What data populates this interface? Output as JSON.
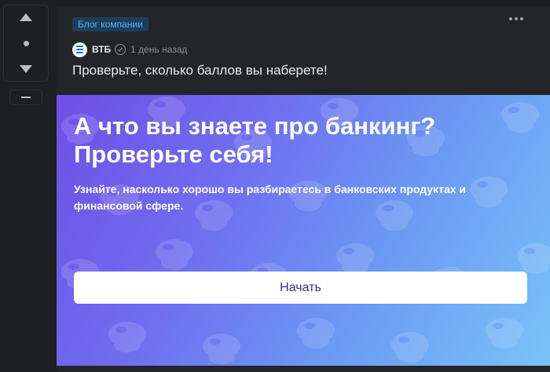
{
  "post": {
    "tag": "Блог компании",
    "author": "ВТБ",
    "time": "1 день назад",
    "title": "Проверьте, сколько баллов вы наберете!"
  },
  "banner": {
    "heading_line1": "А что вы знаете про банкинг?",
    "heading_line2": "Проверьте себя!",
    "subtitle": "Узнайте, насколько хорошо вы разбираетесь в банковских продуктах и финансовой сфере.",
    "button_label": "Начать"
  },
  "colors": {
    "page_bg": "#1d1f22",
    "card_bg": "#232528",
    "tag_bg": "#1d3d5c",
    "tag_text": "#5fb0ee",
    "button_text": "#3f2e84"
  },
  "icons": [
    "upvote-arrow-icon",
    "vote-dot-icon",
    "downvote-arrow-icon",
    "collapse-icon",
    "vtb-logo-icon",
    "verified-check-icon",
    "more-dots-icon"
  ]
}
